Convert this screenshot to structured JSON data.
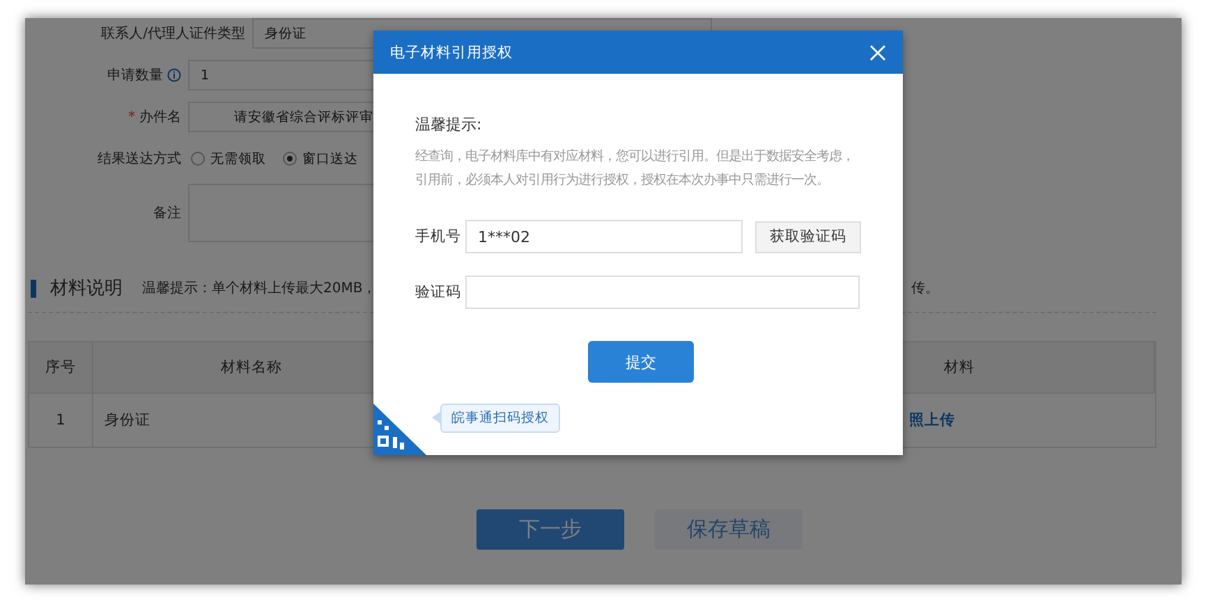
{
  "form": {
    "fields": [
      {
        "kind": "text",
        "label": "联系人/代理人证件类型",
        "value": "身份证"
      },
      {
        "kind": "text",
        "label": "申请数量",
        "info": true,
        "value": "1"
      },
      {
        "kind": "text",
        "label": "办件名",
        "required_mark": "*",
        "value": "请安徽省综合评标评审"
      },
      {
        "kind": "radio",
        "label": "结果送达方式",
        "options": [
          {
            "label": "无需领取",
            "selected": false
          },
          {
            "label": "窗口送达",
            "selected": true
          }
        ]
      },
      {
        "kind": "textarea",
        "label": "备注"
      }
    ]
  },
  "materials": {
    "title": "材料说明",
    "hint": "温馨提示：单个材料上传最大20MB，",
    "hint_tail": "传。",
    "columns": [
      "序号",
      "材料名称",
      "材料"
    ],
    "rows": [
      {
        "cells": [
          "1",
          "身份证"
        ],
        "action": "照上传"
      }
    ]
  },
  "actions": [
    {
      "label": "下一步",
      "kind": "primary"
    },
    {
      "label": "保存草稿",
      "kind": "secondary"
    }
  ],
  "dialog": {
    "title": "电子材料引用授权",
    "notice_title": "温馨提示:",
    "notice": [
      "经查询，电子材料库中有对应材料，您可以进行引用。但是出于数据安全考虑，",
      "引用前，必须本人对引用行为进行授权，授权在本次办事中只需进行一次。"
    ],
    "phone": {
      "label": "手机号",
      "value": "1***02"
    },
    "code_button": "获取验证码",
    "code": {
      "label": "验证码"
    },
    "submit": "提交",
    "qr_tooltip": "皖事通扫码授权"
  }
}
